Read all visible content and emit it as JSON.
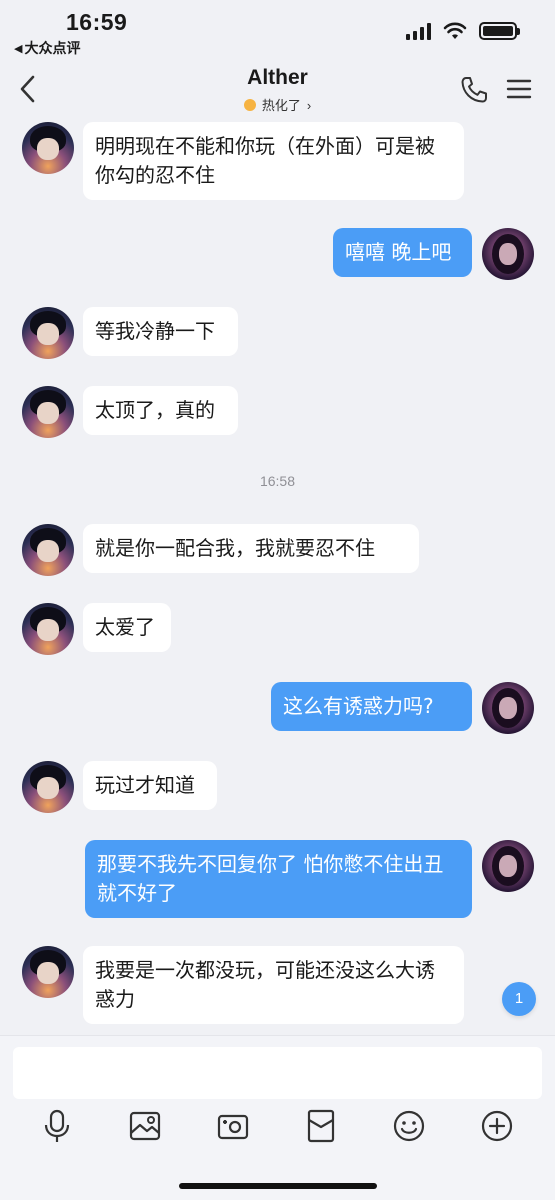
{
  "status_bar": {
    "time": "16:59",
    "back_app": "大众点评",
    "back_glyph": "◀"
  },
  "header": {
    "title": "Alther",
    "subtitle": "热化了",
    "subtitle_chevron": "›"
  },
  "messages": [
    {
      "sender": "other",
      "text": "明明现在不能和你玩（在外面）可是被你勾的忍不住"
    },
    {
      "sender": "me",
      "text": "嘻嘻 晚上吧"
    },
    {
      "sender": "other",
      "text": "等我冷静一下"
    },
    {
      "sender": "other",
      "text": "太顶了，真的"
    },
    {
      "type": "time",
      "text": "16:58"
    },
    {
      "sender": "other",
      "text": "就是你一配合我，我就要忍不住"
    },
    {
      "sender": "other",
      "text": "太爱了"
    },
    {
      "sender": "me",
      "text": "这么有诱惑力吗?"
    },
    {
      "sender": "other",
      "text": "玩过才知道"
    },
    {
      "sender": "me",
      "text": "那要不我先不回复你了 怕你憋不住出丑就不好了"
    },
    {
      "sender": "other",
      "text": "我要是一次都没玩，可能还没这么大诱惑力"
    }
  ],
  "unread_badge": "1",
  "input": {
    "value": "",
    "placeholder": ""
  },
  "toolbar_icons": [
    "microphone-icon",
    "image-icon",
    "camera-icon",
    "red-packet-icon",
    "emoji-icon",
    "plus-icon"
  ],
  "colors": {
    "background": "#f0f1f5",
    "outgoing_bubble": "#4b9df6",
    "incoming_bubble": "#ffffff",
    "accent": "#4b9df6"
  }
}
